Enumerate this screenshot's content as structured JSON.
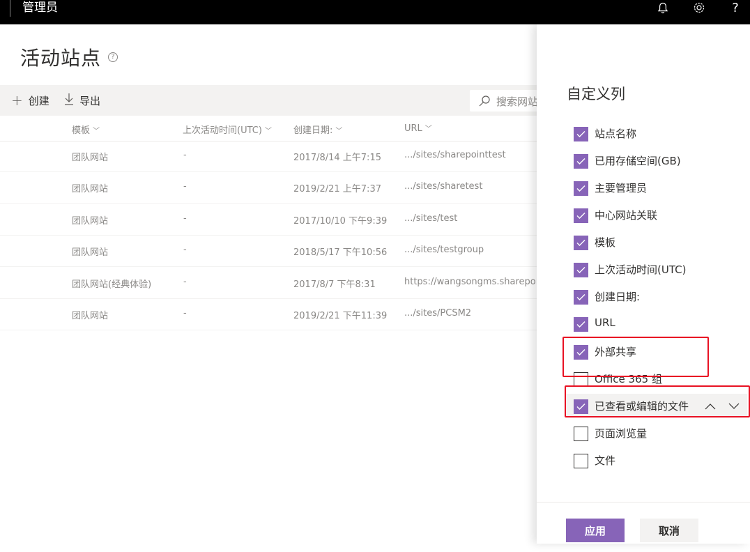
{
  "topbar": {
    "title": "管理员"
  },
  "page": {
    "title": "活动站点",
    "help_icon": "?"
  },
  "commands": {
    "create": "创建",
    "export": "导出",
    "search_placeholder": "搜索网站"
  },
  "columns": [
    "模板",
    "上次活动时间(UTC)",
    "创建日期:",
    "URL"
  ],
  "rows": [
    {
      "template": "团队网站",
      "last_activity": "-",
      "created": "2017/8/14 上午7:15",
      "url": ".../sites/sharepointtest"
    },
    {
      "template": "团队网站",
      "last_activity": "-",
      "created": "2019/2/21 上午7:37",
      "url": ".../sites/sharetest"
    },
    {
      "template": "团队网站",
      "last_activity": "-",
      "created": "2017/10/10 下午9:39",
      "url": ".../sites/test"
    },
    {
      "template": "团队网站",
      "last_activity": "-",
      "created": "2018/5/17 下午10:56",
      "url": ".../sites/testgroup"
    },
    {
      "template": "团队网站(经典体验)",
      "last_activity": "-",
      "created": "2017/8/7 下午8:31",
      "url": "https://wangsongms.sharepoint.com"
    },
    {
      "template": "团队网站",
      "last_activity": "-",
      "created": "2019/2/21 下午11:39",
      "url": ".../sites/PCSM2"
    }
  ],
  "panel": {
    "title": "自定义列",
    "options": [
      {
        "label": "站点名称",
        "checked": true
      },
      {
        "label": "已用存储空间(GB)",
        "checked": true
      },
      {
        "label": "主要管理员",
        "checked": true
      },
      {
        "label": "中心网站关联",
        "checked": true
      },
      {
        "label": "模板",
        "checked": true
      },
      {
        "label": "上次活动时间(UTC)",
        "checked": true
      },
      {
        "label": "创建日期:",
        "checked": true
      },
      {
        "label": "URL",
        "checked": true
      },
      {
        "label": "外部共享",
        "checked": true
      },
      {
        "label": "Office 365 组",
        "checked": false
      },
      {
        "label": "已查看或编辑的文件",
        "checked": true
      },
      {
        "label": "页面浏览量",
        "checked": false
      },
      {
        "label": "文件",
        "checked": false
      }
    ],
    "apply_label": "应用",
    "cancel_label": "取消"
  },
  "colors": {
    "accent": "#8764b8",
    "annotation_red": "#e81123",
    "topbar": "#000000"
  }
}
